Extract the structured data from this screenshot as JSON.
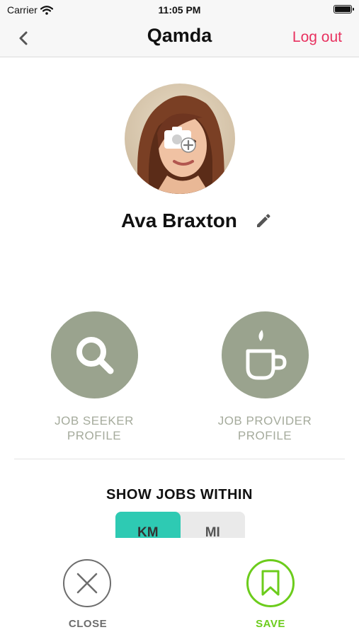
{
  "status_bar": {
    "carrier": "Carrier",
    "time": "11:05 PM"
  },
  "nav": {
    "title": "Qamda",
    "logout_label": "Log out",
    "back_icon": "chevron-left-icon"
  },
  "profile": {
    "name": "Ava Braxton",
    "avatar_icon": "camera-add-icon",
    "edit_icon": "pencil-icon"
  },
  "roles": [
    {
      "label_line1": "JOB SEEKER",
      "label_line2": "PROFILE",
      "icon": "search-icon"
    },
    {
      "label_line1": "JOB PROVIDER",
      "label_line2": "PROFILE",
      "icon": "coffee-cup-icon"
    }
  ],
  "distance": {
    "title": "SHOW JOBS WITHIN",
    "options": [
      "KM",
      "MI"
    ],
    "selected": "KM"
  },
  "actions": {
    "close_label": "CLOSE",
    "save_label": "SAVE"
  },
  "colors": {
    "accent_pink": "#e8315f",
    "role_gray_green": "#9aa38e",
    "segment_teal": "#2ecab3",
    "save_green": "#6ccc1c"
  }
}
